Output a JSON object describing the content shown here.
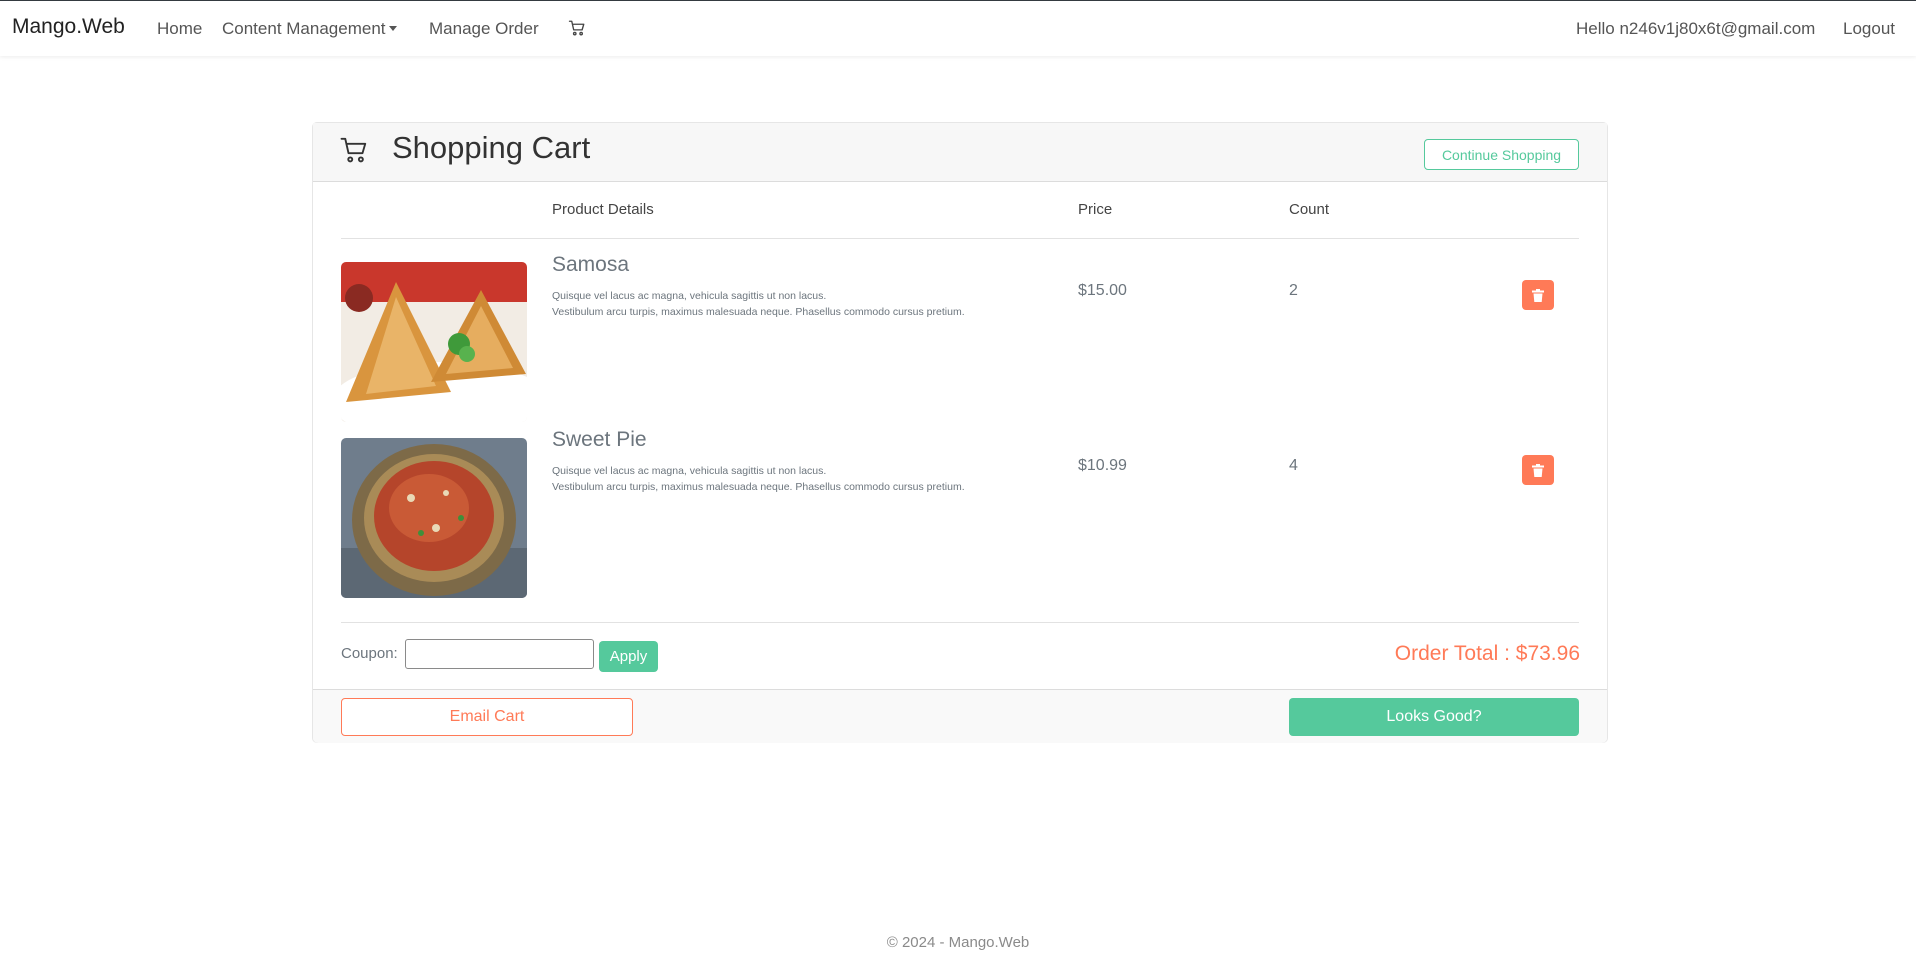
{
  "navbar": {
    "brand": "Mango.Web",
    "links": {
      "home": "Home",
      "content_management": "Content Management",
      "manage_order": "Manage Order"
    },
    "greeting": "Hello n246v1j80x6t@gmail.com",
    "logout": "Logout"
  },
  "cart": {
    "title": "Shopping Cart",
    "continue_label": "Continue Shopping",
    "columns": {
      "details": "Product Details",
      "price": "Price",
      "count": "Count"
    },
    "items": [
      {
        "name": "Samosa",
        "desc_line1": "Quisque vel lacus ac magna, vehicula sagittis ut non lacus.",
        "desc_line2": "Vestibulum arcu turpis, maximus malesuada neque. Phasellus commodo cursus pretium.",
        "price": "$15.00",
        "count": "2"
      },
      {
        "name": "Sweet Pie",
        "desc_line1": "Quisque vel lacus ac magna, vehicula sagittis ut non lacus.",
        "desc_line2": "Vestibulum arcu turpis, maximus malesuada neque. Phasellus commodo cursus pretium.",
        "price": "$10.99",
        "count": "4"
      }
    ],
    "coupon_label": "Coupon:",
    "coupon_value": "",
    "apply_label": "Apply",
    "order_total": "Order Total : $73.96",
    "email_label": "Email Cart",
    "looks_good_label": "Looks Good?"
  },
  "colors": {
    "accent_green": "#55c99c",
    "accent_orange": "#ff7a57"
  },
  "icons": {
    "nav_cart": "cart-icon",
    "header_cart": "cart-icon",
    "delete": "trash-icon"
  },
  "footer": {
    "text": "© 2024 - Mango.Web"
  }
}
